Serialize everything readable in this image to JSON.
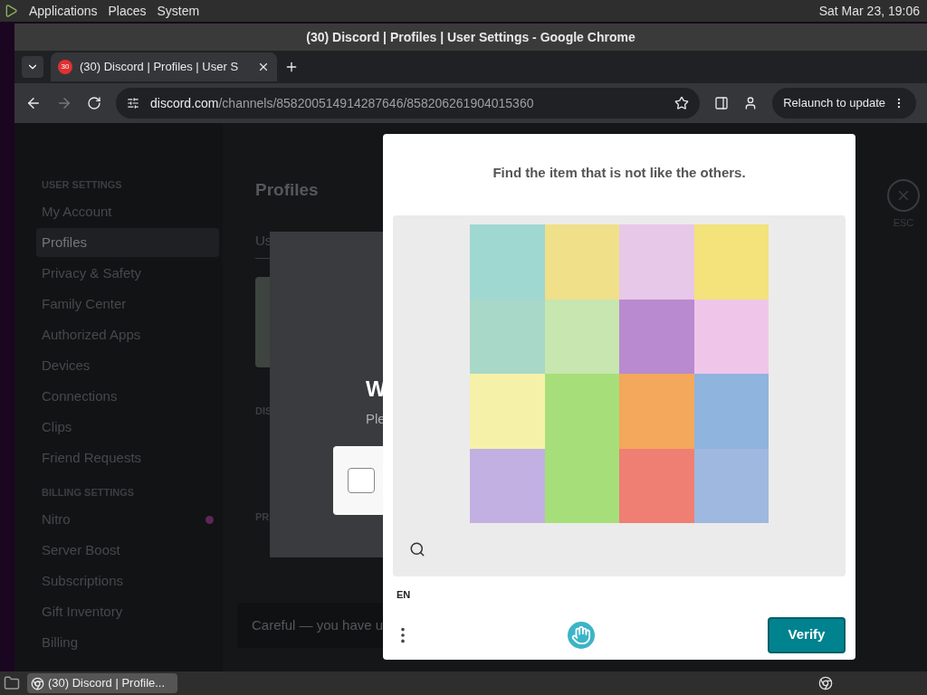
{
  "top_panel": {
    "menus": [
      "Applications",
      "Places",
      "System"
    ],
    "clock": "Sat Mar 23, 19:06"
  },
  "window": {
    "title": "(30) Discord | Profiles | User Settings - Google Chrome"
  },
  "tabs": [
    {
      "label": "(30) Discord | Profiles | User S",
      "badge": "30",
      "selected": true
    }
  ],
  "address_bar": {
    "domain": "discord.com",
    "path": "/channels/858200514914287646/858206261904015360",
    "relaunch": "Relaunch to update"
  },
  "sidebar": {
    "sections": [
      {
        "heading": "USER SETTINGS",
        "items": [
          {
            "label": "My Account",
            "selected": false,
            "dot": false
          },
          {
            "label": "Profiles",
            "selected": true,
            "dot": false
          },
          {
            "label": "Privacy & Safety",
            "selected": false,
            "dot": false
          },
          {
            "label": "Family Center",
            "selected": false,
            "dot": false
          },
          {
            "label": "Authorized Apps",
            "selected": false,
            "dot": false
          },
          {
            "label": "Devices",
            "selected": false,
            "dot": false
          },
          {
            "label": "Connections",
            "selected": false,
            "dot": false
          },
          {
            "label": "Clips",
            "selected": false,
            "dot": false
          },
          {
            "label": "Friend Requests",
            "selected": false,
            "dot": false
          }
        ]
      },
      {
        "heading": "BILLING SETTINGS",
        "items": [
          {
            "label": "Nitro",
            "selected": false,
            "dot": true
          },
          {
            "label": "Server Boost",
            "selected": false,
            "dot": false
          },
          {
            "label": "Subscriptions",
            "selected": false,
            "dot": false
          },
          {
            "label": "Gift Inventory",
            "selected": false,
            "dot": false
          },
          {
            "label": "Billing",
            "selected": false,
            "dot": false
          }
        ]
      }
    ]
  },
  "page": {
    "heading": "Profiles",
    "tab": "Us",
    "label_1": "DIS",
    "label_2": "PR",
    "toast": "Careful — you have u",
    "close": "ESC"
  },
  "back_dialog": {
    "title": "W",
    "text": "Ple",
    "checked": false
  },
  "captcha": {
    "prompt": "Find the item that is not like the others.",
    "language": "EN",
    "verify": "Verify"
  },
  "taskbar": {
    "task": "(30) Discord | Profile..."
  }
}
